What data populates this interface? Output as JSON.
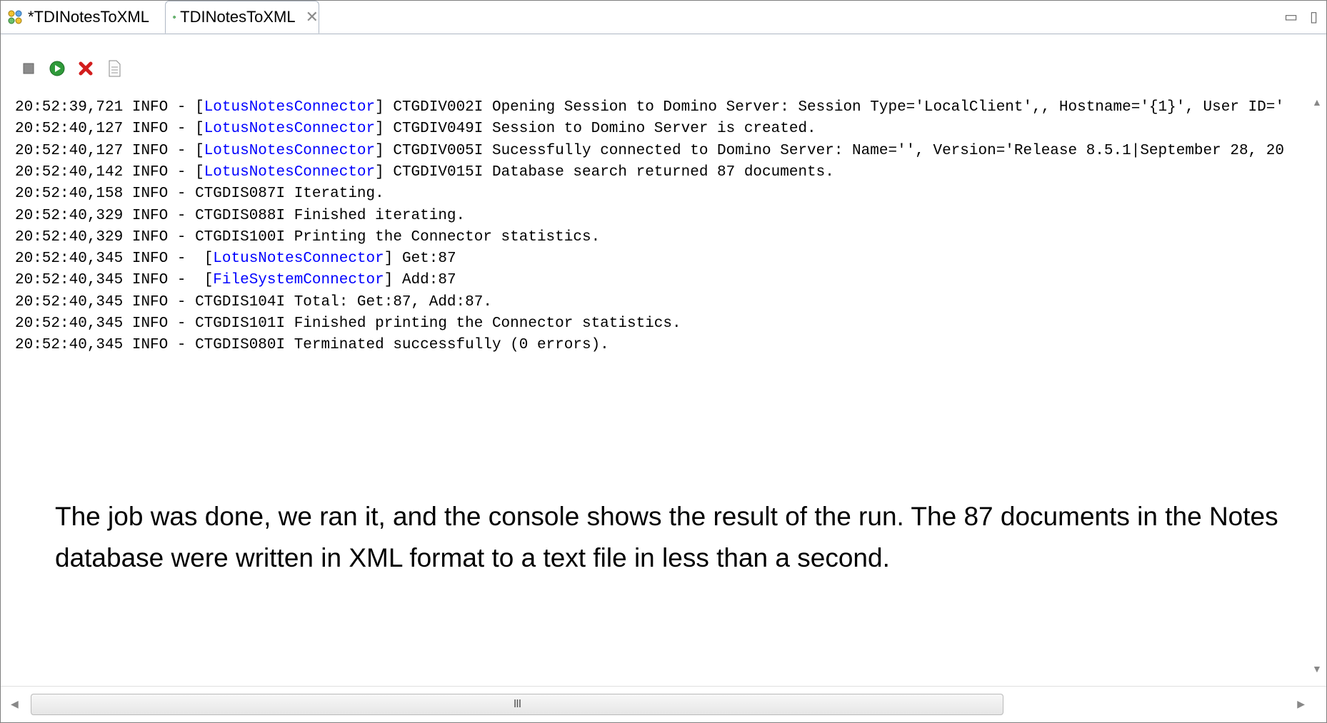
{
  "tabs": [
    {
      "label": "*TDINotesToXML",
      "icon": "connector-icon"
    },
    {
      "label": "TDINotesToXML",
      "icon": "run-icon",
      "close_glyph": "✕"
    }
  ],
  "window_controls": {
    "minimize": "▭",
    "maximize": "▯"
  },
  "toolbar": [
    {
      "name": "stop-button",
      "icon": "stop-icon"
    },
    {
      "name": "run-button",
      "icon": "run-icon"
    },
    {
      "name": "clear-button",
      "icon": "x-icon"
    },
    {
      "name": "log-file-button",
      "icon": "document-icon"
    }
  ],
  "console": {
    "lines": [
      {
        "ts": "20:52:39,721",
        "level": "INFO",
        "sep": " - ",
        "link": "LotusNotesConnector",
        "msg": " CTGDIV002I Opening Session to Domino Server: Session Type='LocalClient',, Hostname='{1}', User ID='"
      },
      {
        "ts": "20:52:40,127",
        "level": "INFO",
        "sep": " - ",
        "link": "LotusNotesConnector",
        "msg": " CTGDIV049I Session to Domino Server is created."
      },
      {
        "ts": "20:52:40,127",
        "level": "INFO",
        "sep": " - ",
        "link": "LotusNotesConnector",
        "msg": " CTGDIV005I Sucessfully connected to Domino Server: Name='', Version='Release 8.5.1|September 28, 20"
      },
      {
        "ts": "20:52:40,142",
        "level": "INFO",
        "sep": " - ",
        "link": "LotusNotesConnector",
        "msg": " CTGDIV015I Database search returned 87 documents."
      },
      {
        "ts": "20:52:40,158",
        "level": "INFO",
        "sep": " - ",
        "link": "",
        "msg": "CTGDIS087I Iterating."
      },
      {
        "ts": "20:52:40,329",
        "level": "INFO",
        "sep": " - ",
        "link": "",
        "msg": "CTGDIS088I Finished iterating."
      },
      {
        "ts": "20:52:40,329",
        "level": "INFO",
        "sep": " - ",
        "link": "",
        "msg": "CTGDIS100I Printing the Connector statistics."
      },
      {
        "ts": "20:52:40,345",
        "level": "INFO",
        "sep": " -  ",
        "link": "LotusNotesConnector",
        "msg": " Get:87"
      },
      {
        "ts": "20:52:40,345",
        "level": "INFO",
        "sep": " -  ",
        "link": "FileSystemConnector",
        "msg": " Add:87"
      },
      {
        "ts": "20:52:40,345",
        "level": "INFO",
        "sep": " - ",
        "link": "",
        "msg": "CTGDIS104I Total: Get:87, Add:87."
      },
      {
        "ts": "20:52:40,345",
        "level": "INFO",
        "sep": " - ",
        "link": "",
        "msg": "CTGDIS101I Finished printing the Connector statistics."
      },
      {
        "ts": "20:52:40,345",
        "level": "INFO",
        "sep": " - ",
        "link": "",
        "msg": "CTGDIS080I Terminated successfully (0 errors)."
      }
    ]
  },
  "annotation": "The job was done, we ran it, and the console shows the result of the run.  The 87 documents in the Notes database were written in XML format to a text file in less than a second.",
  "scrollbar": {
    "grip": "III",
    "left_arrow": "◀",
    "right_arrow": "▶",
    "up_arrow": "▲",
    "down_arrow": "▼"
  }
}
